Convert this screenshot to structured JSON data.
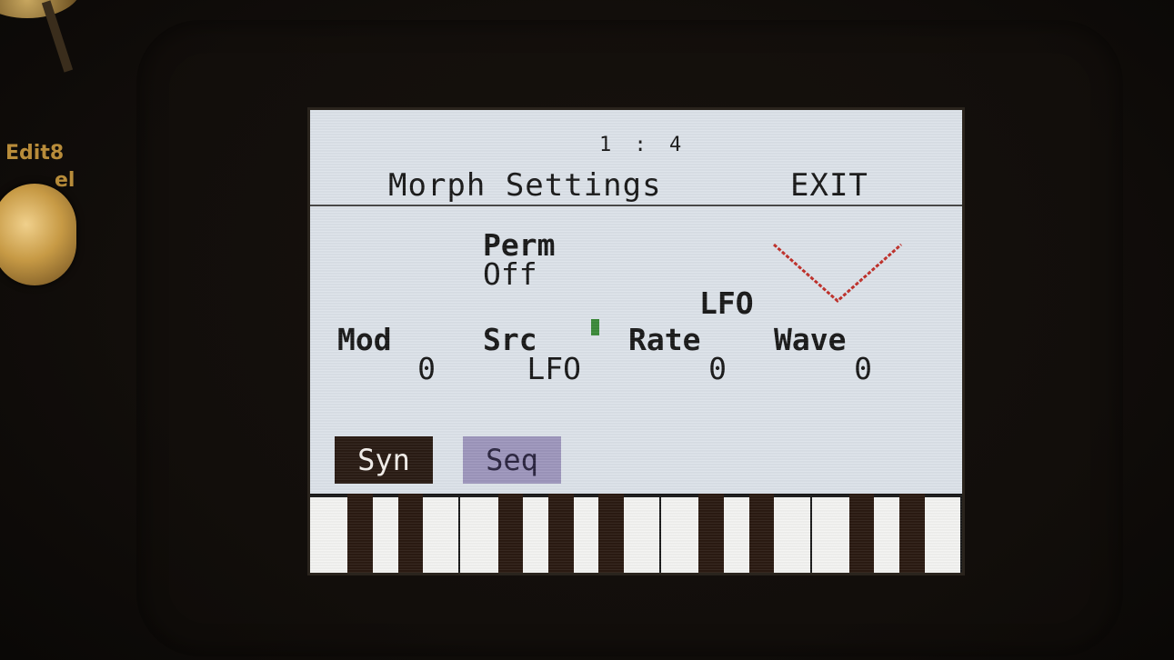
{
  "device": {
    "knob_label_line1": "Edit8",
    "knob_label_line2": "el"
  },
  "screen": {
    "page_indicator": "1 : 4",
    "title": "Morph Settings",
    "exit_label": "EXIT",
    "perm": {
      "label": "Perm",
      "value": "Off"
    },
    "lfo_header": "LFO",
    "params": {
      "mod": {
        "label": "Mod",
        "value": "0"
      },
      "src": {
        "label": "Src",
        "value": "LFO"
      },
      "rate": {
        "label": "Rate",
        "value": "0"
      },
      "wave": {
        "label": "Wave",
        "value": "0"
      }
    },
    "buttons": {
      "syn_label": "Syn",
      "seq_label": "Seq"
    },
    "wave_icon": "triangle-wave-icon",
    "colors": {
      "screen_bg": "#dde3ea",
      "syn_button_bg": "#2a1c14",
      "seq_button_bg": "#9e97bd",
      "wave_line": "#c0302a",
      "cursor": "#3c8a3a",
      "knob_label": "#b88c3a"
    }
  }
}
